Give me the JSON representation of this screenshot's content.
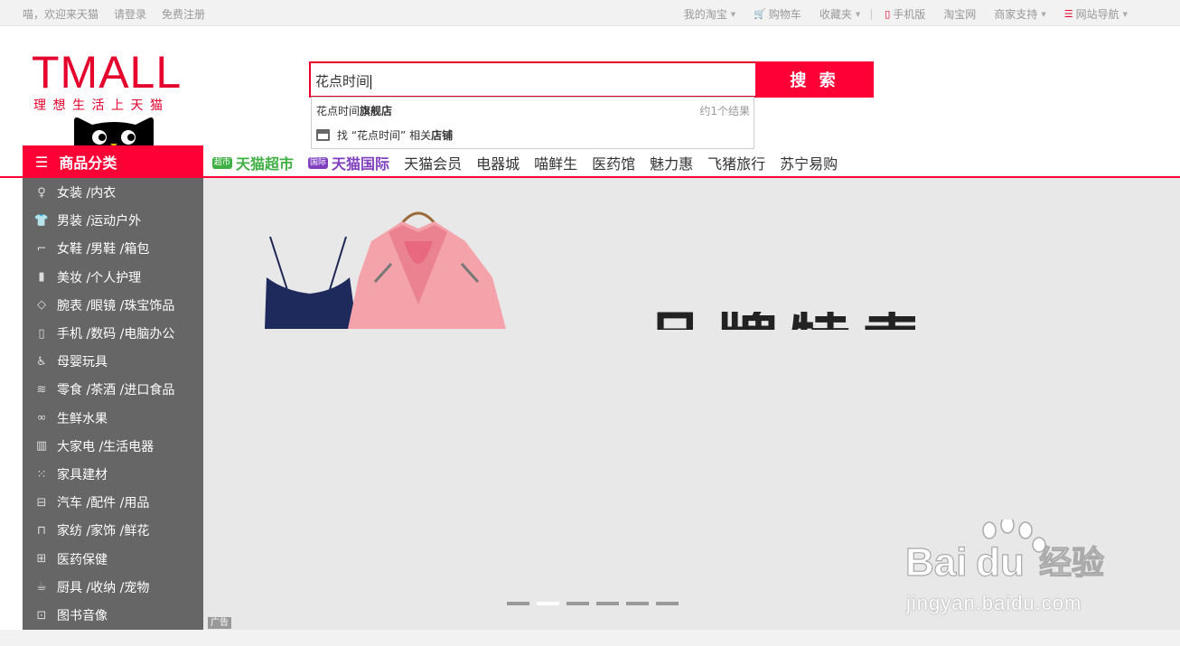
{
  "topbar": {
    "welcome": "喵，欢迎来天猫",
    "login": "请登录",
    "register": "免费注册",
    "my_taobao": "我的淘宝",
    "cart": "购物车",
    "favorites": "收藏夹",
    "mobile": "手机版",
    "taobao": "淘宝网",
    "merchant": "商家支持",
    "sitemap": "网站导航"
  },
  "logo": {
    "text": "TMALL",
    "slogan": "理想生活上天猫"
  },
  "search": {
    "value": "花点时间",
    "button": "搜 索",
    "suggest_prefix": "花点时间",
    "suggest_bold": "旗舰店",
    "suggest_count": "约1个结果",
    "shop_text": "找 “花点时间” 相关",
    "shop_bold": "店铺"
  },
  "nav": {
    "category_tab": "商品分类",
    "chaoshi_badge": "超市",
    "chaoshi": "天猫超市",
    "guoji_badge": "国际",
    "guoji": "天猫国际",
    "items": [
      "天猫会员",
      "电器城",
      "喵鲜生",
      "医药馆",
      "魅力惠",
      "飞猪旅行",
      "苏宁易购"
    ]
  },
  "sidebar": {
    "items": [
      {
        "label": "女装 /内衣",
        "icon": "dress-icon"
      },
      {
        "label": "男装 /运动户外",
        "icon": "shirt-icon"
      },
      {
        "label": "女鞋 /男鞋 /箱包",
        "icon": "shoe-icon"
      },
      {
        "label": "美妆 /个人护理",
        "icon": "lipstick-icon"
      },
      {
        "label": "腕表 /眼镜 /珠宝饰品",
        "icon": "diamond-icon"
      },
      {
        "label": "手机 /数码 /电脑办公",
        "icon": "phone-icon"
      },
      {
        "label": "母婴玩具",
        "icon": "stroller-icon"
      },
      {
        "label": "零食 /茶酒 /进口食品",
        "icon": "bowl-icon"
      },
      {
        "label": "生鲜水果",
        "icon": "bike-icon"
      },
      {
        "label": "大家电 /生活电器",
        "icon": "fridge-icon"
      },
      {
        "label": "家具建材",
        "icon": "grid-icon"
      },
      {
        "label": "汽车 /配件 /用品",
        "icon": "car-icon"
      },
      {
        "label": "家纺 /家饰 /鲜花",
        "icon": "sofa-icon"
      },
      {
        "label": "医药保健",
        "icon": "medicine-icon"
      },
      {
        "label": "厨具 /收纳 /宠物",
        "icon": "cup-icon"
      },
      {
        "label": "图书音像",
        "icon": "lock-icon"
      }
    ]
  },
  "banner": {
    "headline": "品牌特卖",
    "ad_tag": "广告",
    "dots": [
      false,
      true,
      false,
      false,
      false,
      false
    ]
  },
  "watermark": {
    "brand": "Baidu经验",
    "url": "jingyan.baidu.com"
  },
  "colors": {
    "brand_red": "#ff0036",
    "logo_red": "#e4002b",
    "sidebar_gray": "#666666"
  }
}
